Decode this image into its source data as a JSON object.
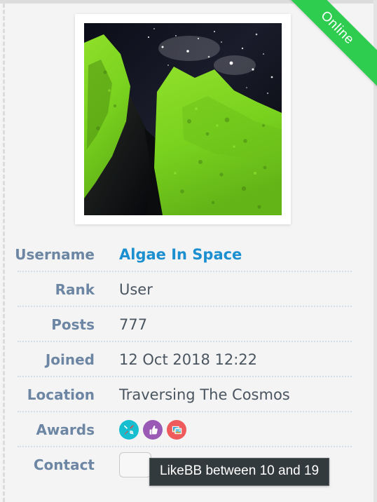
{
  "ribbon": {
    "label": "Online",
    "color": "#2ecc4f"
  },
  "avatar": {
    "alt": "algae covered rocks under a starry sky",
    "colors": {
      "algae_green": "#7ed321",
      "sky_dark": "#06070d",
      "star_white": "#ffffff"
    }
  },
  "profile": {
    "rows": [
      {
        "label": "Username",
        "value": "Algae In Space",
        "type": "link"
      },
      {
        "label": "Rank",
        "value": "User",
        "type": "text"
      },
      {
        "label": "Posts",
        "value": "777",
        "type": "text"
      },
      {
        "label": "Joined",
        "value": "12 Oct 2018 12:22",
        "type": "text"
      },
      {
        "label": "Location",
        "value": "Traversing The Cosmos",
        "type": "text"
      },
      {
        "label": "Awards",
        "value": "",
        "type": "awards"
      },
      {
        "label": "Contact",
        "value": "",
        "type": "contact"
      }
    ],
    "username_color": "#1b8fd0",
    "label_color": "#6c86a3",
    "value_color": "#4a5560"
  },
  "awards": [
    {
      "name": "tools-badge",
      "title": "Tools",
      "color": "#17bed0",
      "icon": "wrench-screwdriver-icon"
    },
    {
      "name": "thumbs-up-badge",
      "title": "LikeBB",
      "color": "#9b59b6",
      "icon": "thumbs-up-icon"
    },
    {
      "name": "photos-badge",
      "title": "Photos",
      "color": "#ef5a5a",
      "icon": "photos-icon"
    }
  ],
  "tooltip": {
    "text": "LikeBB between 10 and 19",
    "background": "#333a3d",
    "text_color": "#ffffff"
  },
  "theme": {
    "page_background": "#f4f4f4",
    "divider_color": "#d3dfec",
    "card_background": "#ffffff"
  }
}
